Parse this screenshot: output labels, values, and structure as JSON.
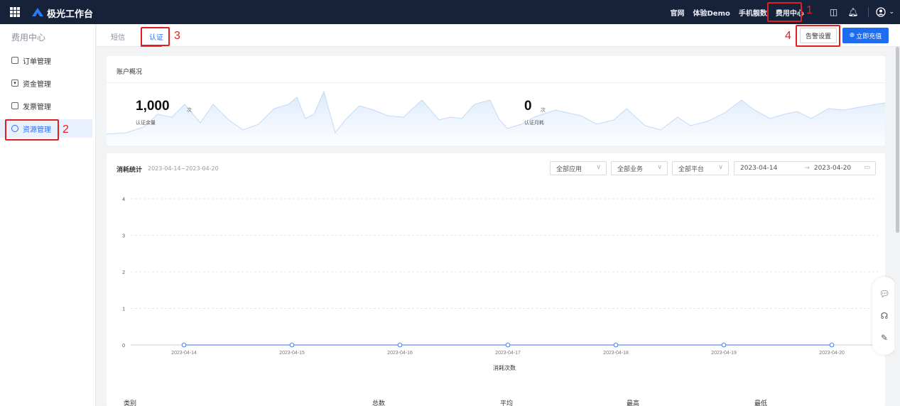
{
  "topbar": {
    "brand": "极光工作台",
    "nav": [
      "官网",
      "体验Demo",
      "手机靓数",
      "费用中心"
    ]
  },
  "annotations": {
    "one": "1",
    "two": "2",
    "three": "3",
    "four": "4"
  },
  "sidebar": {
    "title": "费用中心",
    "items": [
      {
        "label": "订单管理",
        "icon": "document-icon"
      },
      {
        "label": "资金管理",
        "icon": "wallet-icon"
      },
      {
        "label": "发票管理",
        "icon": "invoice-icon"
      },
      {
        "label": "资源管理",
        "icon": "cube-icon"
      }
    ]
  },
  "tabs": {
    "items": [
      "短信",
      "认证"
    ],
    "alert_button": "告警设置",
    "recharge_button": "立即充值"
  },
  "overview": {
    "title": "账户概况",
    "balance_value": "1,000",
    "balance_unit": "次",
    "balance_label": "认证余量",
    "monthly_value": "0",
    "monthly_unit": "次",
    "monthly_label": "认证月耗"
  },
  "consumption": {
    "title": "消耗统计",
    "date_range": "2023-04-14~2023-04-20",
    "filters": {
      "app": "全部应用",
      "business": "全部业务",
      "platform": "全部平台",
      "start_date": "2023-04-14",
      "arrow": "→",
      "end_date": "2023-04-20"
    },
    "columns": [
      "类别",
      "总数",
      "平均",
      "最高",
      "最低"
    ]
  },
  "chart_data": {
    "type": "line",
    "x": [
      "2023-04-14",
      "2023-04-15",
      "2023-04-16",
      "2023-04-17",
      "2023-04-18",
      "2023-04-19",
      "2023-04-20"
    ],
    "series": [
      {
        "name": "",
        "values": [
          0,
          0,
          0,
          0,
          0,
          0,
          0
        ]
      }
    ],
    "y_ticks": [
      "0",
      "1",
      "2",
      "3",
      "4"
    ],
    "ylim": [
      0,
      4
    ],
    "xlabel": "消耗次数",
    "grid": true,
    "color": "#5b8ff9"
  },
  "colors": {
    "primary": "#1e6cf0",
    "topbar": "#16213a",
    "annotation": "#e02020"
  }
}
